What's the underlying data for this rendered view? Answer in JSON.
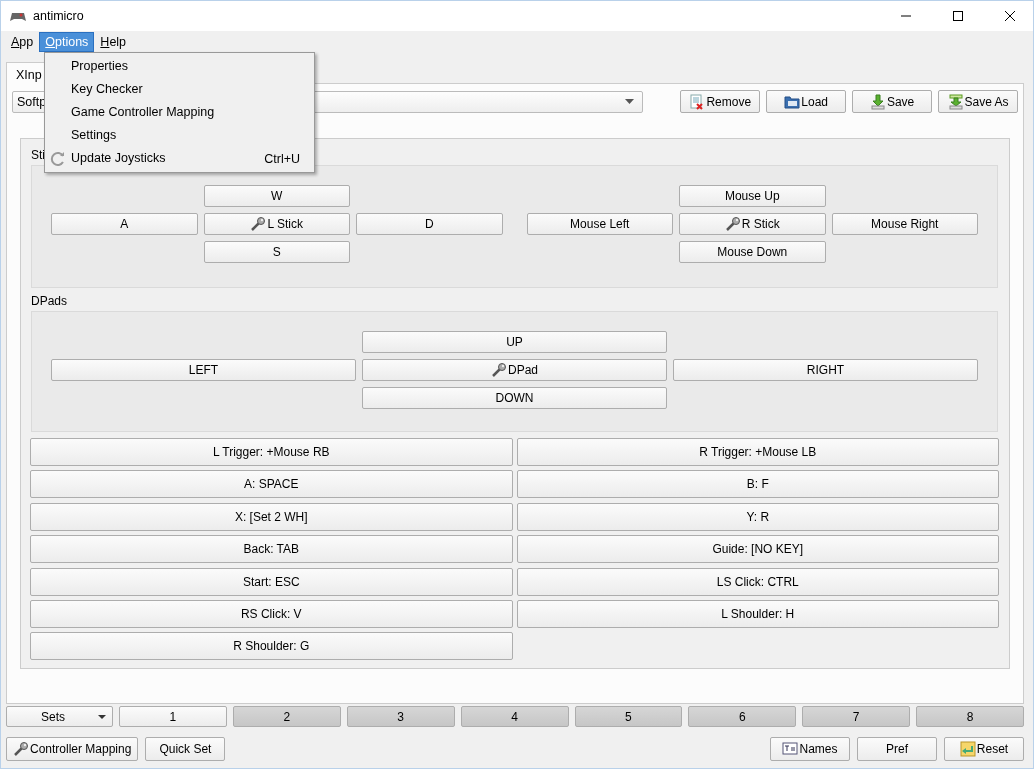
{
  "window": {
    "title": "antimicro"
  },
  "menu_bar": [
    {
      "label": "App",
      "selected": false
    },
    {
      "label": "Options",
      "selected": true
    },
    {
      "label": "Help",
      "selected": false
    }
  ],
  "open_menu": [
    {
      "label": "Properties"
    },
    {
      "label": "Key Checker"
    },
    {
      "label": "Game Controller Mapping"
    },
    {
      "label": "Settings"
    },
    {
      "label": "Update Joysticks",
      "shortcut": "Ctrl+U"
    }
  ],
  "tabs": [
    {
      "label": "XInp",
      "selected": true
    }
  ],
  "profile_combo": {
    "value": "Softp"
  },
  "toolbar_buttons": [
    {
      "label": "Remove"
    },
    {
      "label": "Load"
    },
    {
      "label": "Save"
    },
    {
      "label": "Save As"
    }
  ],
  "sticks": {
    "label": "Sti",
    "groups": [
      {
        "up": "W",
        "left": "A",
        "center": "L Stick",
        "right": "D",
        "down": "S"
      },
      {
        "up": "Mouse Up",
        "left": "Mouse Left",
        "center": "R Stick",
        "right": "Mouse Right",
        "down": "Mouse Down"
      }
    ]
  },
  "dpads": {
    "label": "DPads",
    "group": {
      "up": "UP",
      "left": "LEFT",
      "center": "DPad",
      "right": "RIGHT",
      "down": "DOWN"
    }
  },
  "buttons": [
    "L Trigger: +Mouse RB",
    "R Trigger: +Mouse LB",
    "A: SPACE",
    "B: F",
    "X: [Set 2 WH]",
    "Y: R",
    "Back: TAB",
    "Guide: [NO KEY]",
    "Start: ESC",
    "LS Click: CTRL",
    "RS Click: V",
    "L Shoulder: H",
    "R Shoulder: G"
  ],
  "sets": {
    "dropdown": "Sets",
    "items": [
      {
        "label": "1",
        "selected": true
      },
      {
        "label": "2",
        "selected": false
      },
      {
        "label": "3",
        "selected": false
      },
      {
        "label": "4",
        "selected": false
      },
      {
        "label": "5",
        "selected": false
      },
      {
        "label": "6",
        "selected": false
      },
      {
        "label": "7",
        "selected": false
      },
      {
        "label": "8",
        "selected": false
      }
    ]
  },
  "bottom_left": [
    {
      "label": "Controller Mapping"
    },
    {
      "label": "Quick Set"
    }
  ],
  "bottom_right": [
    {
      "label": "Names"
    },
    {
      "label": "Pref"
    },
    {
      "label": "Reset"
    }
  ]
}
